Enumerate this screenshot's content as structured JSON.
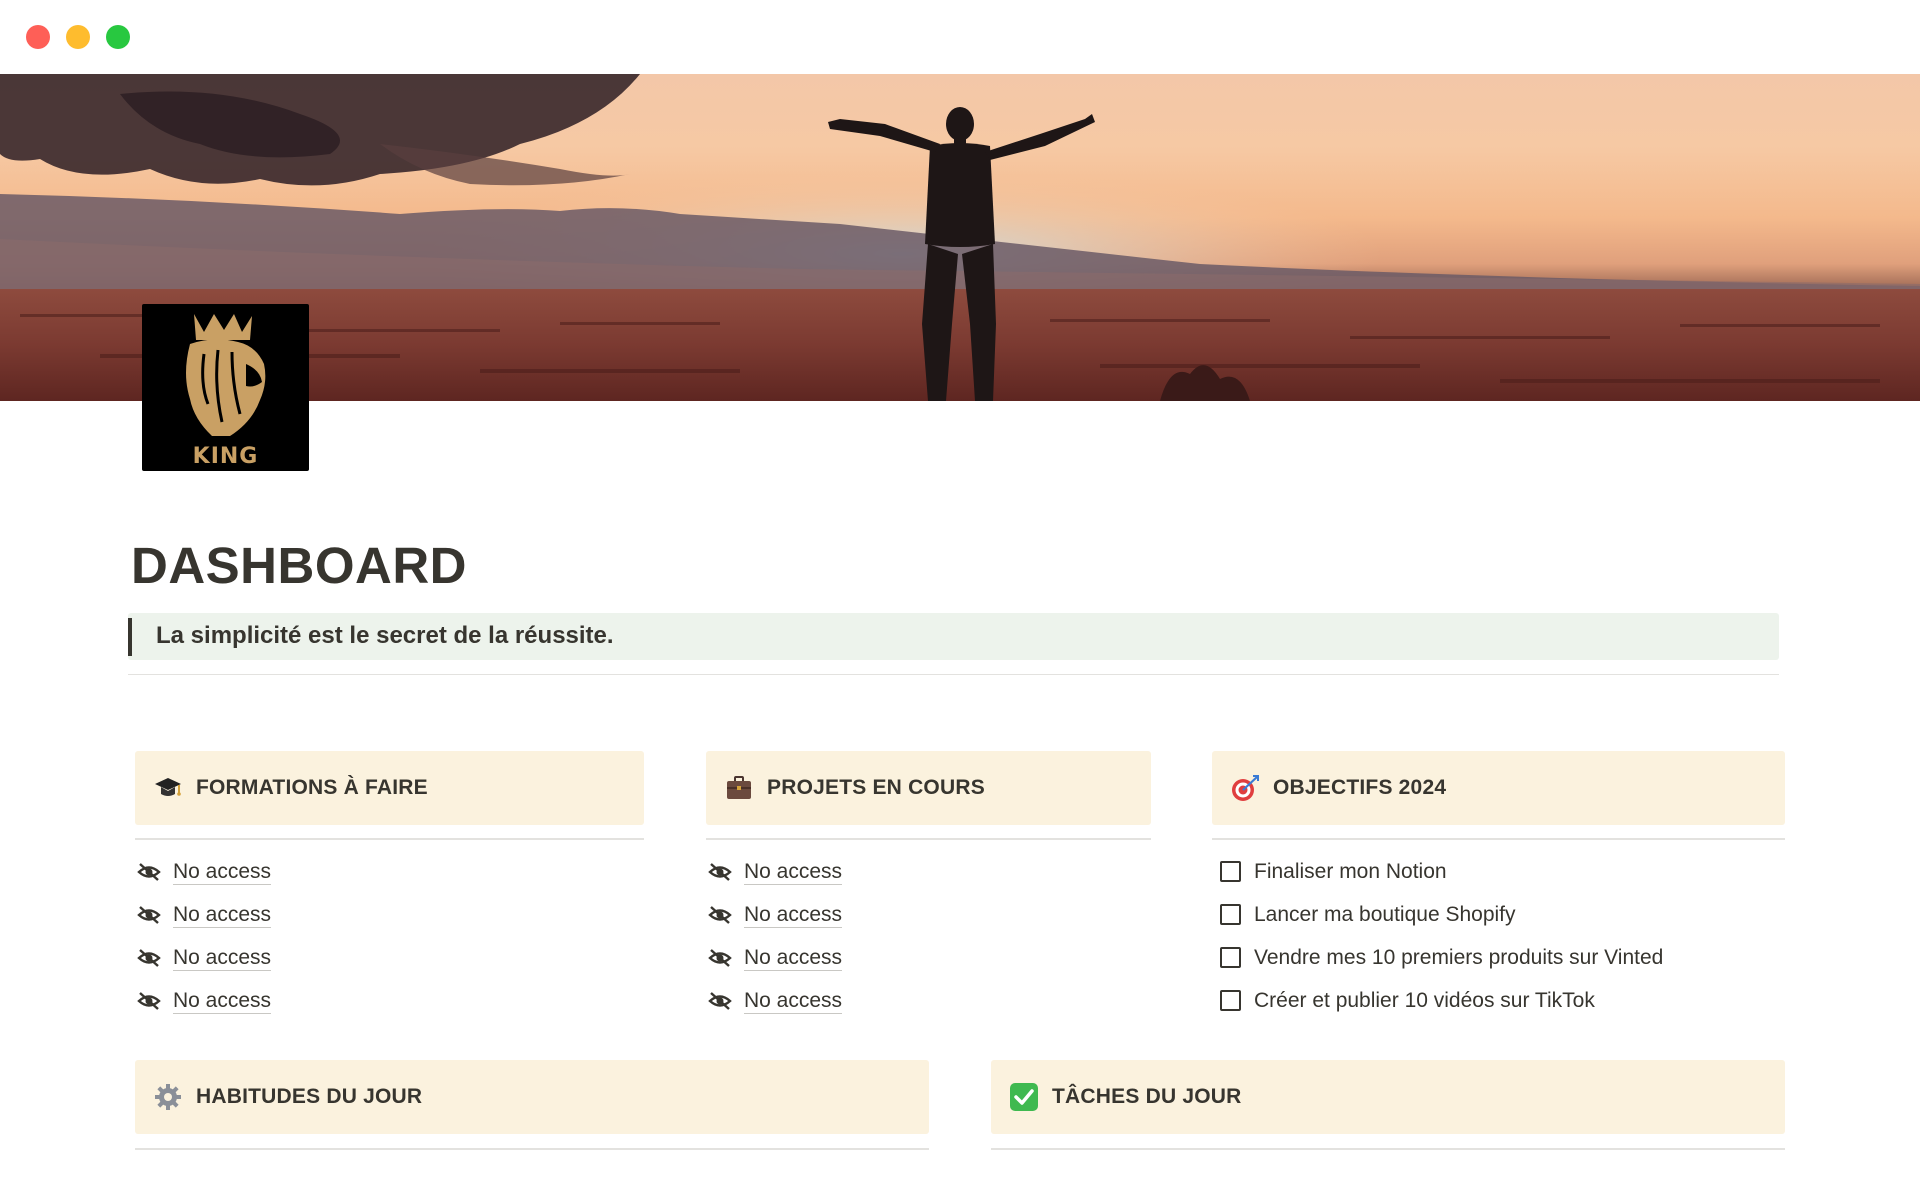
{
  "window": {
    "controls": [
      "close",
      "minimize",
      "zoom"
    ]
  },
  "page": {
    "title": "DASHBOARD",
    "quote": "La simplicité est le secret de la réussite.",
    "logo_text": "KING"
  },
  "formations": {
    "title": "FORMATIONS À FAIRE",
    "icon": "graduation-cap-icon",
    "items": [
      "No access",
      "No access",
      "No access",
      "No access"
    ]
  },
  "projets": {
    "title": "PROJETS EN COURS",
    "icon": "briefcase-icon",
    "items": [
      "No access",
      "No access",
      "No access",
      "No access"
    ]
  },
  "objectifs": {
    "title": "OBJECTIFS 2024",
    "icon": "target-icon",
    "items": [
      "Finaliser mon Notion",
      "Lancer ma boutique Shopify",
      "Vendre mes 10 premiers produits sur Vinted",
      "Créer et publier 10 vidéos sur TikTok"
    ]
  },
  "habitudes": {
    "title": "HABITUDES DU JOUR",
    "icon": "gear-icon"
  },
  "taches": {
    "title": "TÂCHES DU JOUR",
    "icon": "check-mark-icon"
  },
  "colors": {
    "callout_bg": "#edf3ec",
    "header_bg": "#fbf2de",
    "text": "#37352f"
  }
}
